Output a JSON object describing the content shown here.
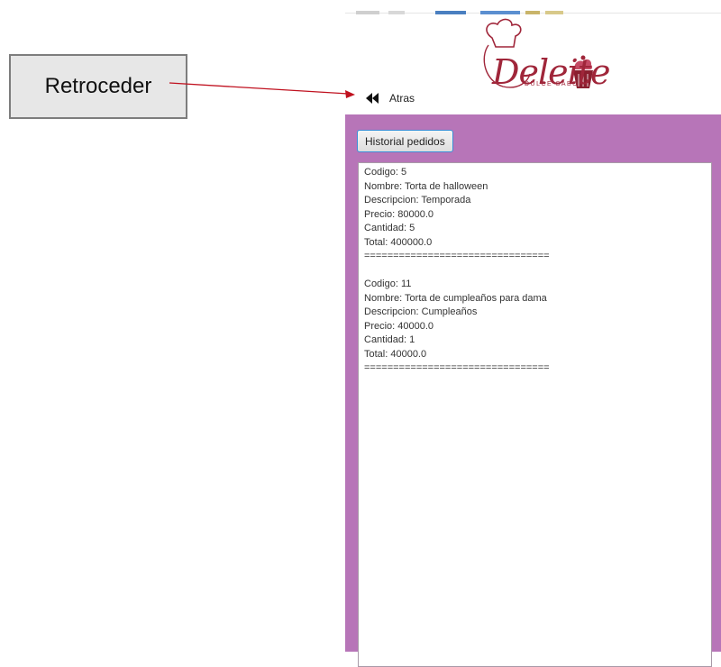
{
  "annotation": {
    "label": "Retroceder"
  },
  "logo": {
    "script_text": "Deleite",
    "subtitle": "DULCE SABOR"
  },
  "back": {
    "label": "Atras",
    "icon": "rewind-icon"
  },
  "history_button": {
    "label": "Historial pedidos"
  },
  "orders": [
    {
      "codigo": "Codigo: 5",
      "nombre": "Nombre: Torta de halloween",
      "descripcion": "Descripcion: Temporada",
      "precio": "Precio: 80000.0",
      "cantidad": "Cantidad: 5",
      "total": "Total: 400000.0",
      "separator": "================================"
    },
    {
      "codigo": "Codigo: 11",
      "nombre": "Nombre: Torta de cumpleaños para dama",
      "descripcion": "Descripcion: Cumpleaños",
      "precio": "Precio: 40000.0",
      "cantidad": "Cantidad: 1",
      "total": "Total: 40000.0",
      "separator": "================================"
    }
  ],
  "colors": {
    "panel": "#b775b8",
    "brand": "#a0263a",
    "annotation_arrow": "#c0111f",
    "button_border": "#3a8fd8"
  }
}
